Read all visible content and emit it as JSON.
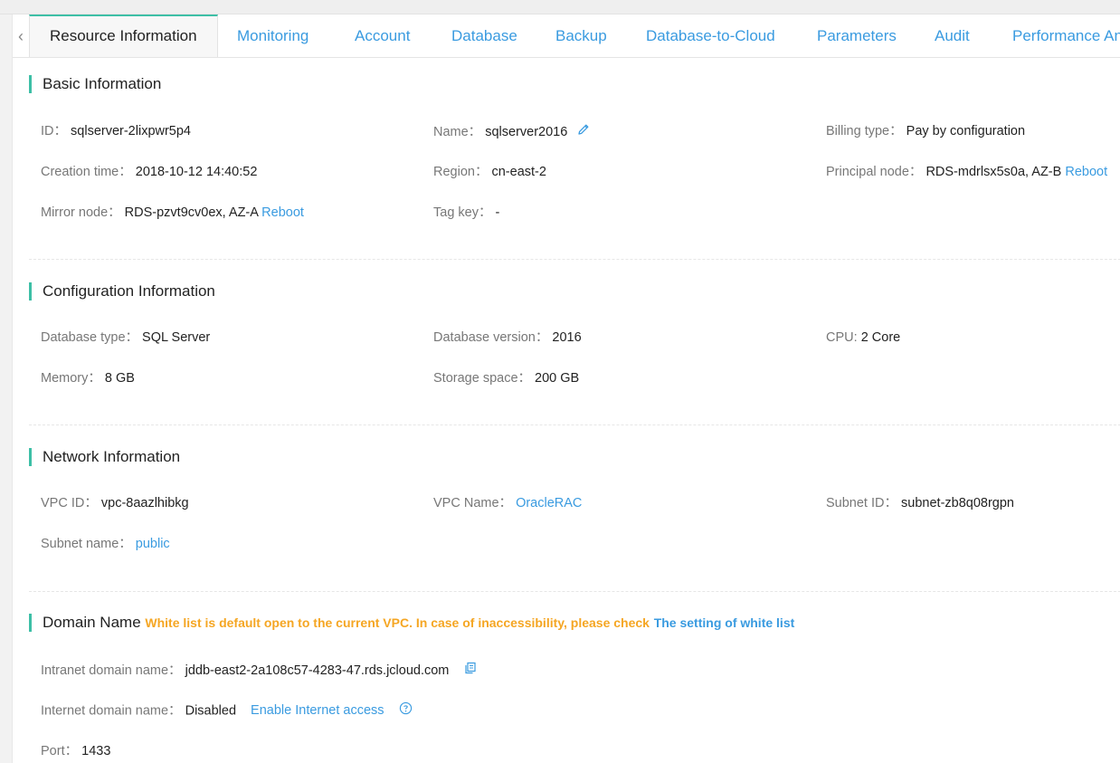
{
  "tabs": [
    {
      "label": "Resource Information",
      "active": true
    },
    {
      "label": "Monitoring"
    },
    {
      "label": "Account"
    },
    {
      "label": "Database"
    },
    {
      "label": "Backup"
    },
    {
      "label": "Database-to-Cloud"
    },
    {
      "label": "Parameters"
    },
    {
      "label": "Audit"
    },
    {
      "label": "Performance An"
    }
  ],
  "basic": {
    "title": "Basic Information",
    "id_label": "ID：",
    "id_value": "sqlserver-2lixpwr5p4",
    "name_label": "Name：",
    "name_value": "sqlserver2016",
    "billing_label": "Billing type：",
    "billing_value": "Pay by configuration",
    "creation_label": "Creation time：",
    "creation_value": "2018-10-12 14:40:52",
    "region_label": "Region：",
    "region_value": "cn-east-2",
    "principal_label": "Principal node：",
    "principal_value": "RDS-mdrlsx5s0a, AZ-B",
    "principal_reboot": "Reboot",
    "mirror_label": "Mirror node：",
    "mirror_value": "RDS-pzvt9cv0ex, AZ-A",
    "mirror_reboot": "Reboot",
    "tag_label": "Tag key：",
    "tag_value": "-"
  },
  "config": {
    "title": "Configuration Information",
    "dbtype_label": "Database type：",
    "dbtype_value": "SQL Server",
    "dbver_label": "Database version：",
    "dbver_value": "2016",
    "cpu_label": "CPU:",
    "cpu_value": "2 Core",
    "memory_label": "Memory：",
    "memory_value": "8 GB",
    "storage_label": "Storage space：",
    "storage_value": "200 GB"
  },
  "network": {
    "title": "Network Information",
    "vpcid_label": "VPC ID：",
    "vpcid_value": "vpc-8aazlhibkg",
    "vpcname_label": "VPC Name：",
    "vpcname_value": "OracleRAC",
    "subnetid_label": "Subnet ID：",
    "subnetid_value": "subnet-zb8q08rgpn",
    "subnetname_label": "Subnet name：",
    "subnetname_value": "public"
  },
  "domain": {
    "title": "Domain Name",
    "notice": "White list is default open to the current VPC. In case of inaccessibility, please check",
    "notice_link": "The setting of white list",
    "intranet_label": "Intranet domain name：",
    "intranet_value": "jddb-east2-2a108c57-4283-47.rds.jcloud.com",
    "internet_label": "Internet domain name：",
    "internet_value": "Disabled",
    "internet_link": "Enable Internet access",
    "port_label": "Port：",
    "port_value": "1433"
  },
  "icons": {
    "tab_prev": "chevron-left-icon",
    "edit": "pencil-icon",
    "copy": "copy-icon",
    "help": "question-circle-icon"
  },
  "colors": {
    "accent": "#3dbfa6",
    "link": "#3a9be0",
    "warning": "#f5a623"
  }
}
